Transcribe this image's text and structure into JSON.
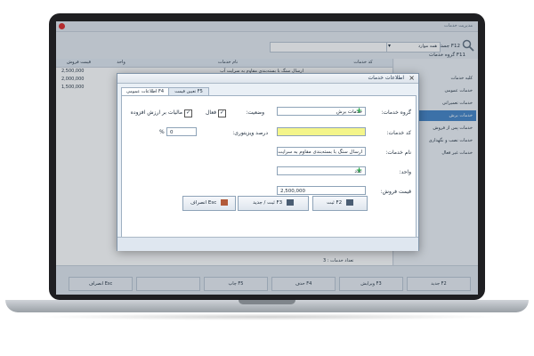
{
  "app": {
    "title": "مدیریت خدمات",
    "search_label": "جستجو F12",
    "field_label": "همه موارد",
    "group_label": "گروه خدمات F11"
  },
  "grid": {
    "columns": [
      "کد خدمات",
      "نام خدمات",
      "واحد",
      "قیمت فروش"
    ],
    "rows": [
      {
        "code": "",
        "name": "ارسال سنگ با بسته‌بندی مقاوم به سرایت آب",
        "unit": "",
        "price": "2,500,000"
      },
      {
        "code": "",
        "name": "",
        "unit": "",
        "price": "2,000,000"
      },
      {
        "code": "",
        "name": "",
        "unit": "",
        "price": "1,500,000"
      }
    ],
    "count_label": "تعداد خدمات : 3"
  },
  "side": {
    "items": [
      "کلیه خدمات",
      "خدمات عمومی",
      "خدمات تعمیراتی",
      "خدمات برش",
      "خدمات پس از فروش",
      "خدمات نصب و نگهداری",
      "خدمات غیر فعال"
    ],
    "selected_index": 3
  },
  "bottom": {
    "buttons": [
      "جدید F2",
      "ویرایش F3",
      "حذف F4",
      "چاپ F5",
      "",
      "انصراف Esc"
    ]
  },
  "dialog": {
    "title": "اطلاعات خدمات",
    "close": "×",
    "tabs": [
      "اطلاعات عمومی F4",
      "تعیین قیمت F5"
    ],
    "active_tab": 0,
    "labels": {
      "group": "گروه خدمات:",
      "code": "کد خدمات:",
      "name": "نام خدمات:",
      "unit": "واحد:",
      "price": "قیمت فروش:",
      "status": "وضعیت:",
      "active": "فعال",
      "vat": "مالیات بر ارزش افزوده",
      "discount": "درصد ویزیتوری:"
    },
    "values": {
      "group": "خدمات برش",
      "code": "",
      "name": "ارسال سنگ با بسته‌بندی مقاوم به سرایت",
      "unit": "عدد",
      "price": "2,500,000",
      "discount": "0",
      "discount_unit": "%"
    },
    "checkboxes": {
      "active": true,
      "vat": true
    },
    "footer_buttons": {
      "save": "ثبت F2",
      "save_new": "ثبت / جدید F3",
      "cancel": "انصراف Esc"
    }
  },
  "colors": {
    "accent": "#3a6ea5",
    "selected_side": "#3d7fc4",
    "highlight_field": "#f4f58a",
    "plus": "#1aa23c"
  }
}
